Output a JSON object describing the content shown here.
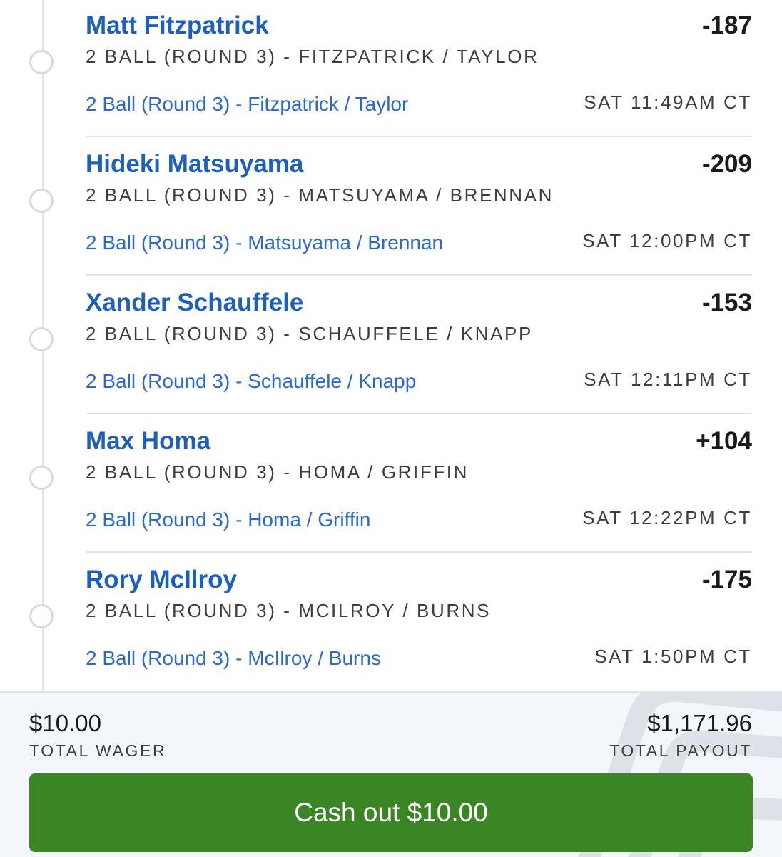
{
  "legs": [
    {
      "name": "Matt Fitzpatrick",
      "odds": "-187",
      "market": "2 BALL (ROUND 3) - FITZPATRICK / TAYLOR",
      "event": "2 Ball (Round 3) - Fitzpatrick / Taylor",
      "time": "SAT 11:49AM CT"
    },
    {
      "name": "Hideki Matsuyama",
      "odds": "-209",
      "market": "2 BALL (ROUND 3) - MATSUYAMA / BRENNAN",
      "event": "2 Ball (Round 3) - Matsuyama / Brennan",
      "time": "SAT 12:00PM CT"
    },
    {
      "name": "Xander Schauffele",
      "odds": "-153",
      "market": "2 BALL (ROUND 3) - SCHAUFFELE / KNAPP",
      "event": "2 Ball (Round 3) - Schauffele / Knapp",
      "time": "SAT 12:11PM CT"
    },
    {
      "name": "Max Homa",
      "odds": "+104",
      "market": "2 BALL (ROUND 3) - HOMA / GRIFFIN",
      "event": "2 Ball (Round 3) - Homa / Griffin",
      "time": "SAT 12:22PM CT"
    },
    {
      "name": "Rory McIlroy",
      "odds": "-175",
      "market": "2 BALL (ROUND 3) - MCILROY / BURNS",
      "event": "2 Ball (Round 3) - McIlroy / Burns",
      "time": "SAT 1:50PM CT"
    }
  ],
  "summary": {
    "total_wager": "$10.00",
    "total_wager_label": "TOTAL WAGER",
    "total_payout": "$1,171.96",
    "total_payout_label": "TOTAL PAYOUT"
  },
  "cashout": {
    "label": "Cash out $10.00"
  },
  "colors": {
    "accent_blue": "#1d5fbf",
    "cashout_green": "#3b8624"
  },
  "icons": {
    "leg_status": "open-circle-icon",
    "watermark": "brand-logo-watermark"
  }
}
